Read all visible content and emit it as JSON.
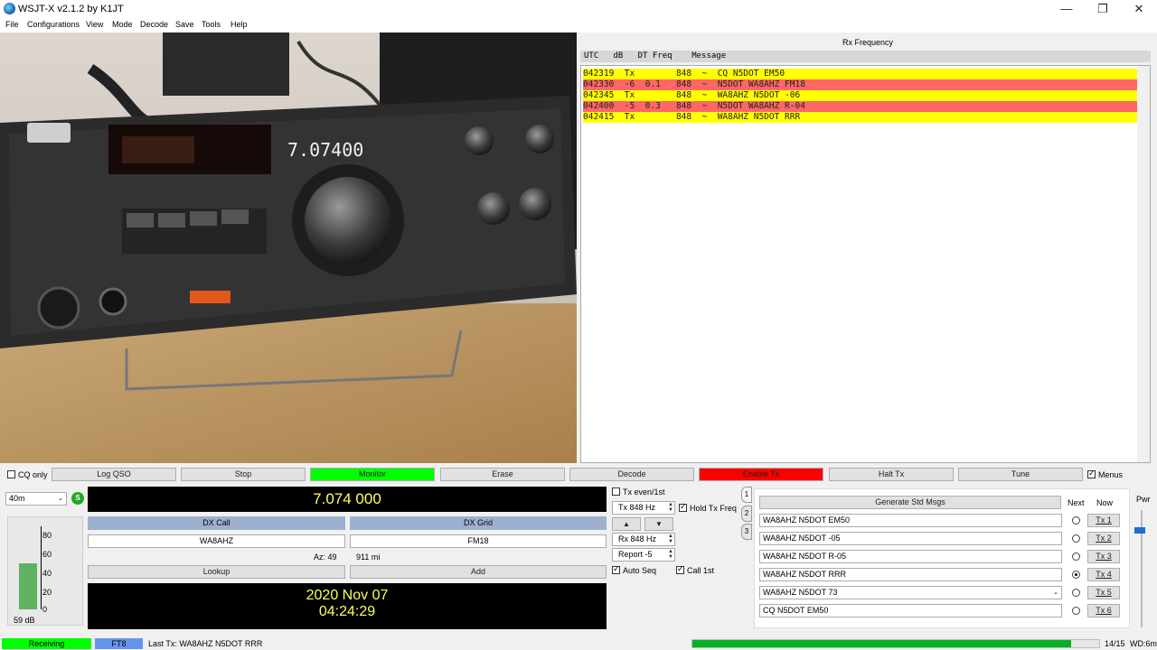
{
  "window": {
    "title": "WSJT-X   v2.1.2   by K1JT"
  },
  "menu": [
    "File",
    "Configurations",
    "View",
    "Mode",
    "Decode",
    "Save",
    "Tools",
    "Help"
  ],
  "rx": {
    "heading": "Rx Frequency",
    "columns": "UTC   dB   DT Freq    Message",
    "rows": [
      {
        "text": "042319  Tx        848  ~  CQ N5DOT EM50",
        "color": "#ffff00"
      },
      {
        "text": "042330  -6  0.1   848  ~  N5DOT WA8AHZ FM18",
        "color": "#ff6666"
      },
      {
        "text": "042345  Tx        848  ~  WA8AHZ N5DOT -06",
        "color": "#ffff00"
      },
      {
        "text": "042400  -5  0.3   848  ~  N5DOT WA8AHZ R-04",
        "color": "#ff6666"
      },
      {
        "text": "042415  Tx        848  ~  WA8AHZ N5DOT RRR",
        "color": "#ffff00"
      }
    ]
  },
  "buttons": {
    "cq_only": "CQ only",
    "log_qso": "Log QSO",
    "stop": "Stop",
    "monitor": "Monitor",
    "erase": "Erase",
    "decode": "Decode",
    "enable_tx": "Enable Tx",
    "halt_tx": "Halt Tx",
    "tune": "Tune",
    "menus": "Menus"
  },
  "colors": {
    "monitor": "#00ff00",
    "enable_tx": "#ff0000",
    "tx_row": "#ffff00",
    "rx_row": "#ff6666",
    "receiving": "#00ff00",
    "mode": "#6495ed"
  },
  "band": "40m",
  "frequency": "7.074 000",
  "dx": {
    "call_label": "DX Call",
    "grid_label": "DX Grid",
    "call": "WA8AHZ",
    "grid": "FM18",
    "az": "Az: 49",
    "dist": "911 mi",
    "lookup": "Lookup",
    "add": "Add"
  },
  "clock": {
    "date": "2020 Nov 07",
    "time": "04:24:29"
  },
  "meter": {
    "ticks": [
      "80",
      "60",
      "40",
      "20",
      "0"
    ],
    "level_db": "59 dB",
    "level_fraction": 0.6
  },
  "tx_controls": {
    "tx_even": "Tx even/1st",
    "tx_freq": "Tx  848  Hz",
    "hold": "Hold Tx Freq",
    "up": "▲",
    "down": "▼",
    "rx_freq": "Rx  848  Hz",
    "report": "Report -5",
    "auto_seq": "Auto Seq",
    "call_1st": "Call 1st"
  },
  "side_tabs": [
    "1",
    "2",
    "3"
  ],
  "msgs": {
    "generate": "Generate Std Msgs",
    "next": "Next",
    "now": "Now",
    "items": [
      {
        "text": "WA8AHZ N5DOT EM50",
        "btn": "Tx 1"
      },
      {
        "text": "WA8AHZ N5DOT -05",
        "btn": "Tx 2"
      },
      {
        "text": "WA8AHZ N5DOT R-05",
        "btn": "Tx 3"
      },
      {
        "text": "WA8AHZ N5DOT RRR",
        "btn": "Tx 4"
      },
      {
        "text": "WA8AHZ N5DOT 73",
        "btn": "Tx 5"
      },
      {
        "text": "CQ N5DOT EM50",
        "btn": "Tx 6"
      }
    ],
    "selected_next": 3
  },
  "pwr": {
    "label": "Pwr"
  },
  "status": {
    "receiving": "Receiving",
    "mode": "FT8",
    "last_tx": "Last Tx: WA8AHZ N5DOT RRR",
    "progress_fraction": 0.93,
    "count": "14/15",
    "wd": "WD:6m"
  }
}
